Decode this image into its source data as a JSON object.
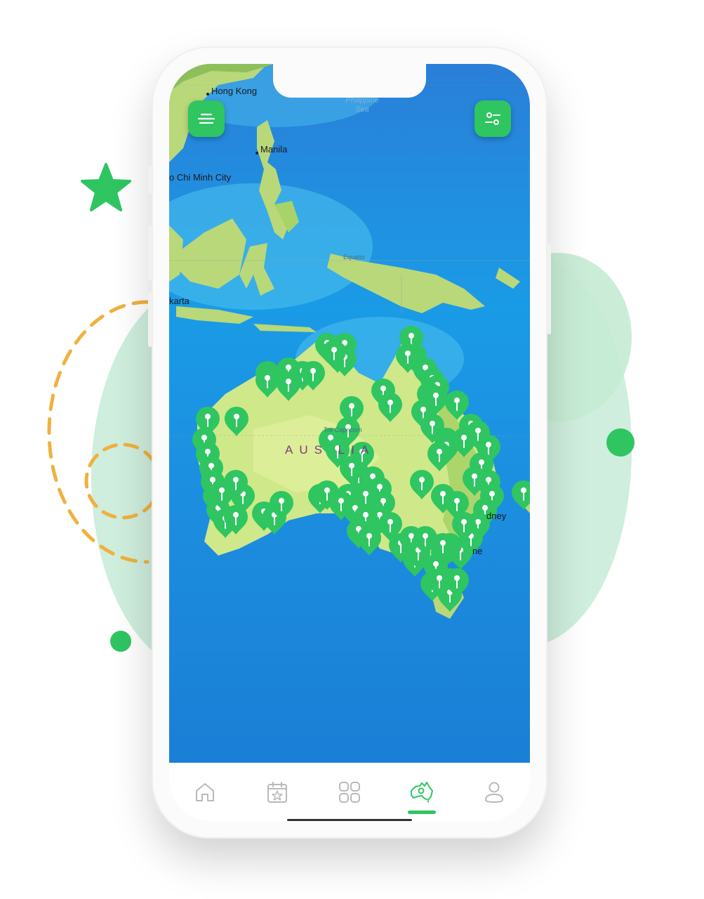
{
  "colors": {
    "accent": "#2fc561",
    "ocean": "#1e8ee0",
    "land": "#c9e57e",
    "decoration": "#cfeedd",
    "dashes": "#f0b13e"
  },
  "map": {
    "city_labels": {
      "hong_kong": "Hong Kong",
      "manila": "Manila",
      "ho_chi_minh": "o Chi Minh City",
      "jakarta": "karta",
      "sydney": "dney",
      "melbourne": "ne"
    },
    "sea_labels": {
      "philippine_sea": "Philippine\nSea"
    },
    "country_label": "AUS  LIA",
    "tropic_label": "Tre     Capricorn",
    "equator_label": "Equator",
    "pin_icon": "map-pin-icon",
    "pin_count": 95
  },
  "buttons": {
    "menu_icon": "menu-icon",
    "filter_icon": "filter-sliders-icon"
  },
  "tabbar": {
    "tabs": [
      {
        "name": "home",
        "icon": "home-icon",
        "active": false
      },
      {
        "name": "events",
        "icon": "calendar-star-icon",
        "active": false
      },
      {
        "name": "categories",
        "icon": "grid-icon",
        "active": false
      },
      {
        "name": "map",
        "icon": "australia-map-icon",
        "active": true
      },
      {
        "name": "profile",
        "icon": "user-icon",
        "active": false
      }
    ]
  }
}
